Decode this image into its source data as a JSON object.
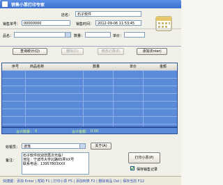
{
  "window": {
    "title": "销售小票打印专家"
  },
  "header": {
    "store_label": "店名：",
    "store_value": "石子软件",
    "receipt_no_label": "销售单号：",
    "receipt_no_value": "00000000",
    "time_label": "销售时间：",
    "time_value": "2012-09-06 11:53:45"
  },
  "entry": {
    "product_label": "品名：",
    "qty_label": "数量：",
    "price_label": "单价：",
    "add_button": "添加(Enter)",
    "query_button": "查询统计(Q)",
    "delete_button": "删除(D)",
    "edit_button": "修改记录(E)"
  },
  "table": {
    "columns": [
      "序号",
      "商品名称",
      "数量",
      "单价",
      "金额"
    ]
  },
  "totals": {
    "total_qty_label": "合计数量：",
    "total_qty_value": "0",
    "total_amount_label": "合计金额：",
    "total_amount_value": "0.00"
  },
  "footer": {
    "cashier_label": "收银员：",
    "cashier_value": "波落",
    "remark_label": "备注：",
    "remark_text": "石子软件欢迎您再次光临！\n地址：宁波市大学北路65弄XX号\n联系电话：13957803XXX",
    "about_button": "关于(A)",
    "print_button": "打印小票(P)",
    "save_label": "保存销售记录",
    "save_checked": true
  },
  "status": {
    "text": "快捷键：添加 Enter | 帮助 F1 | 打印小票 F5 | 添加到表 F2 | 删除商品 Del | 保存当前 F12"
  },
  "colors": {
    "accent": "#3a6fd0",
    "table_bg": "#5a8ad8",
    "totals_text": "#d4ff7a"
  }
}
